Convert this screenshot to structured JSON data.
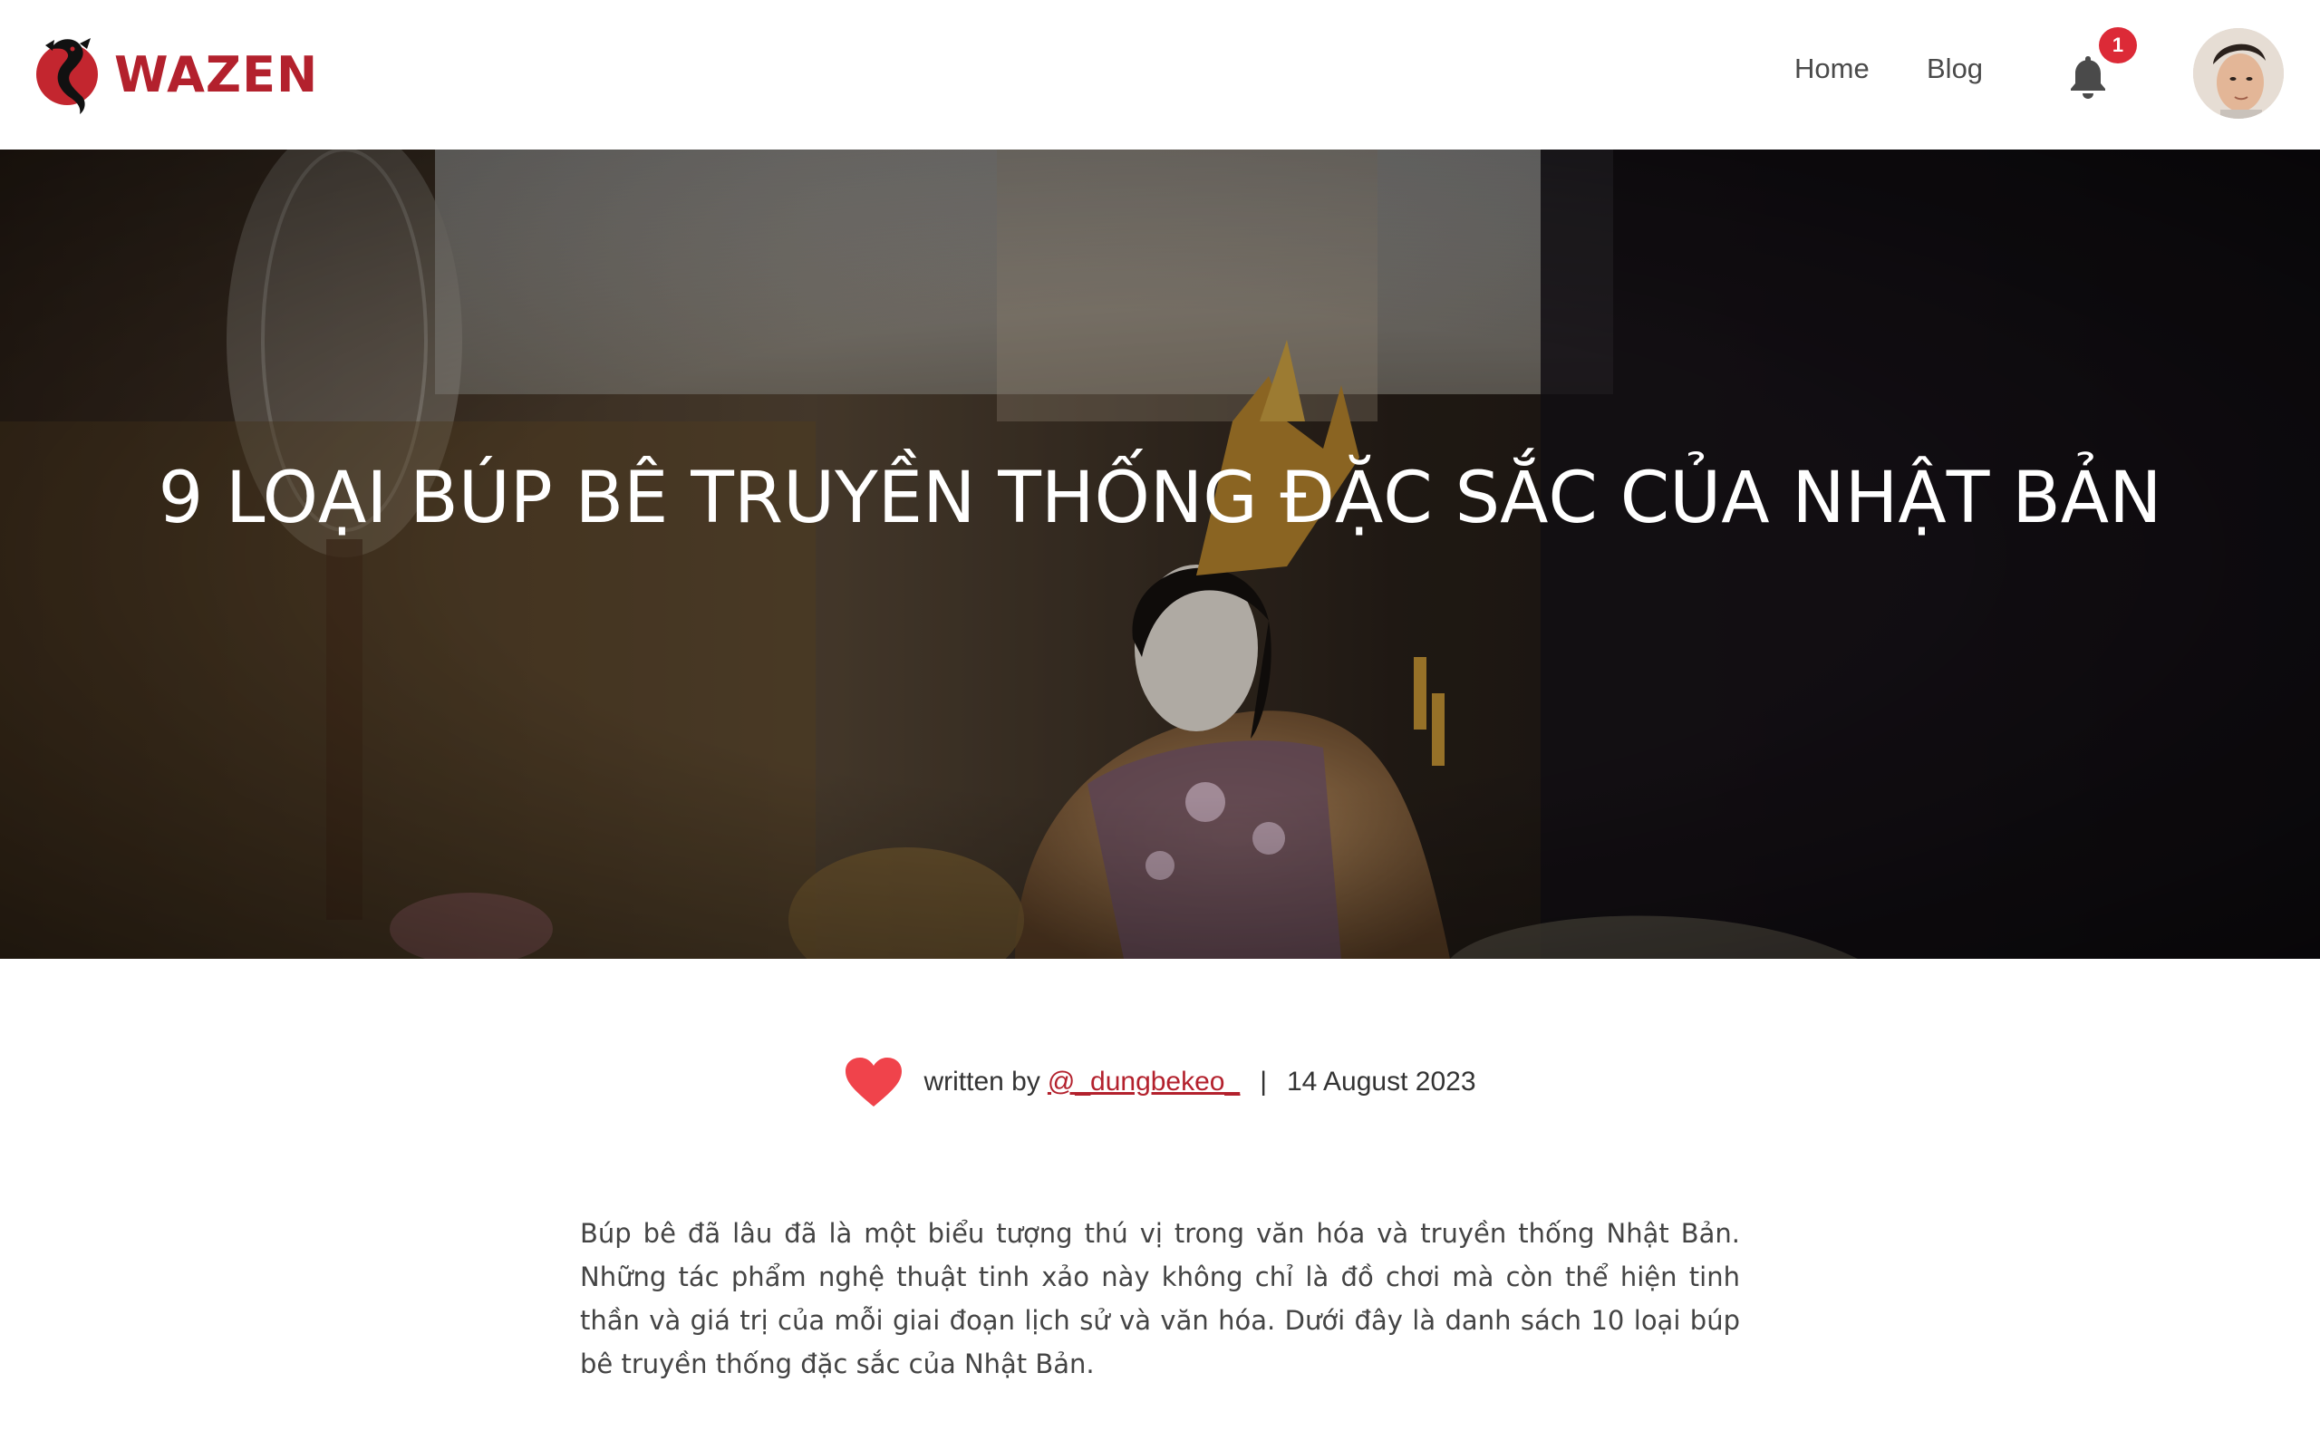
{
  "header": {
    "logo_text": "WAZEN",
    "nav": {
      "home": "Home",
      "blog": "Blog"
    },
    "notification_count": "1"
  },
  "hero": {
    "title": "9 LOẠI BÚP BÊ TRUYỀN THỐNG ĐẶC SẮC CỦA NHẬT BẢN"
  },
  "meta": {
    "written_by": "written by",
    "author": "@_dungbekeo_",
    "separator": "|",
    "date": "14 August 2023"
  },
  "article": {
    "intro": "Búp bê đã lâu đã là một biểu tượng thú vị trong văn hóa và truyền thống Nhật Bản. Những tác phẩm nghệ thuật tinh xảo này không chỉ là đồ chơi mà còn thể hiện tinh thần và giá trị của mỗi giai đoạn lịch sử và văn hóa. Dưới đây là danh sách 10 loại búp bê truyền thống đặc sắc của Nhật Bản."
  },
  "colors": {
    "brand": "#b3212d",
    "badge": "#dc2a37",
    "heart": "#f0434b"
  }
}
